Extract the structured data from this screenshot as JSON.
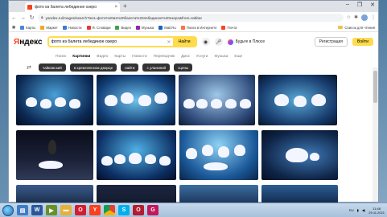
{
  "browser": {
    "tab_title": "фото из балета лебединое озеро",
    "url": "yandex.ru/images/search?text=фото%20из%20балета%20лебединое%20озеро&from=tabbar",
    "bookmarks": [
      "Карты",
      "Маркет",
      "Новости",
      "Я. Словари",
      "Видео",
      "Музыка",
      "Mail.Ru",
      "Поиск в Интернете",
      "Почта"
    ],
    "bookmarks_other": "Список для чтения"
  },
  "yandex": {
    "logo_first": "Я",
    "logo_rest": "ндекс",
    "query": "фото из балета лебединое озеро",
    "search_button": "Найти",
    "plus_label": "Будьте в Плюсе",
    "register": "Регистрация",
    "login": "Войти",
    "services": [
      "Поиск",
      "Картинки",
      "Видео",
      "Карты",
      "Новости",
      "Переводчик",
      "Диск",
      "Услуги",
      "Музыка",
      "Еще"
    ],
    "active_service": "Картинки",
    "chips": [
      "чайковский",
      "в кремлевском дворце",
      "найти",
      "с улановой",
      "сцены"
    ]
  },
  "taskbar": {
    "time": "11:48",
    "date": "29.11.2021"
  },
  "colors": {
    "yandex_yellow": "#ffdb4d",
    "yandex_red": "#fc3f1d"
  }
}
